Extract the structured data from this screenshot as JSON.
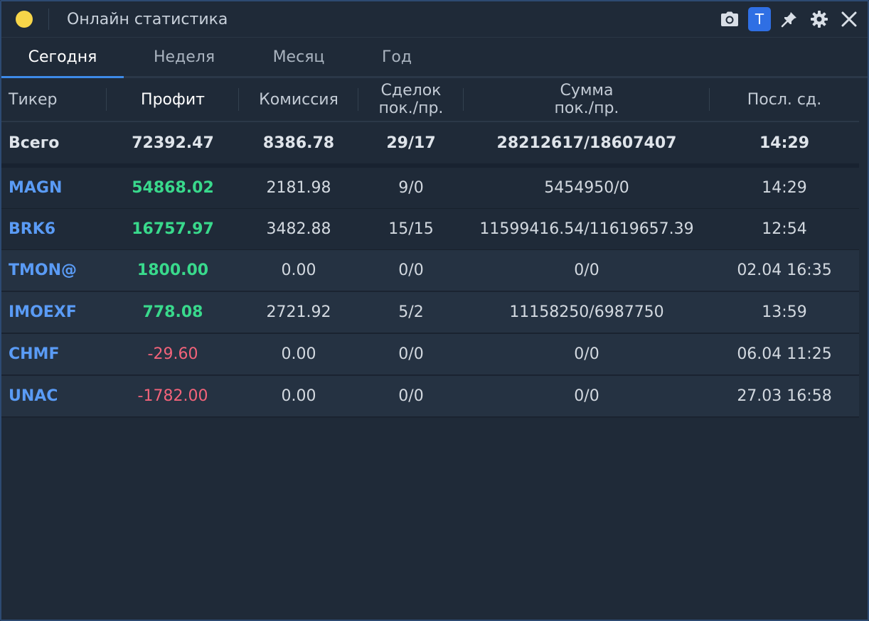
{
  "window": {
    "title": "Онлайн статистика",
    "t_button_label": "T",
    "icons": [
      "camera-icon",
      "pin-icon",
      "gear-icon",
      "close-icon"
    ]
  },
  "tabs": [
    {
      "label": "Сегодня",
      "active": true
    },
    {
      "label": "Неделя",
      "active": false
    },
    {
      "label": "Месяц",
      "active": false
    },
    {
      "label": "Год",
      "active": false
    }
  ],
  "table": {
    "headers": {
      "ticker": "Тикер",
      "profit": "Профит",
      "commission": "Комиссия",
      "deals_line1": "Сделок",
      "deals_line2": "пок./пр.",
      "sum_line1": "Сумма",
      "sum_line2": "пок./пр.",
      "last": "Посл. сд."
    },
    "total": {
      "ticker": "Всего",
      "profit": "72392.47",
      "commission": "8386.78",
      "deals": "29/17",
      "sum": "28212617/18607407",
      "last": "14:29"
    },
    "rows": [
      {
        "ticker": "MAGN",
        "profit": "54868.02",
        "commission": "2181.98",
        "deals": "9/0",
        "sum": "5454950/0",
        "last": "14:29"
      },
      {
        "ticker": "BRK6",
        "profit": "16757.97",
        "commission": "3482.88",
        "deals": "15/15",
        "sum": "11599416.54/11619657.39",
        "last": "12:54"
      },
      {
        "ticker": "TMON@",
        "profit": "1800.00",
        "commission": "0.00",
        "deals": "0/0",
        "sum": "0/0",
        "last": "02.04 16:35"
      },
      {
        "ticker": "IMOEXF",
        "profit": "778.08",
        "commission": "2721.92",
        "deals": "5/2",
        "sum": "11158250/6987750",
        "last": "13:59"
      },
      {
        "ticker": "CHMF",
        "profit": "-29.60",
        "commission": "0.00",
        "deals": "0/0",
        "sum": "0/0",
        "last": "06.04 11:25"
      },
      {
        "ticker": "UNAC",
        "profit": "-1782.00",
        "commission": "0.00",
        "deals": "0/0",
        "sum": "0/0",
        "last": "27.03 16:58"
      }
    ]
  },
  "colors": {
    "positive": "#39d98c",
    "negative": "#f2637a",
    "ticker": "#5a9bf5",
    "accent": "#3d8ae8",
    "status_dot": "#f7d549"
  }
}
